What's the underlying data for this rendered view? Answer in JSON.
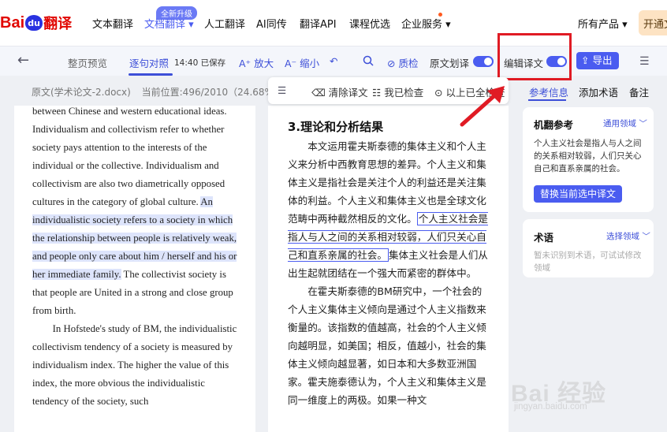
{
  "nav": {
    "logo_text_1": "Bai",
    "logo_paw": "du",
    "logo_text_2": "翻译",
    "items": [
      "文本翻译",
      "文档翻译 ▾",
      "人工翻译",
      "AI同传",
      "翻译API",
      "课程优选",
      "企业服务 ▾"
    ],
    "new_badge": "全新升级",
    "all_products": "所有产品 ▾",
    "trial_label": "开通文"
  },
  "toolbar": {
    "back_icon": "←",
    "preview_tab": "整页预览",
    "compare_tab": "逐句对照",
    "saved_status": "14:40 已保存",
    "zoom_in": "放大",
    "zoom_out": "缩小",
    "quality_check": "质检",
    "source_hint": "原文划译",
    "edit_translation": "编辑译文",
    "export": "导出"
  },
  "doc_info": {
    "filename": "原文(学术论文-2.docx)",
    "position": "当前位置:496/2010（24.68%"
  },
  "float_toolbar": {
    "clear": "清除译文",
    "checked": "我已检查",
    "above_checked": "以上已全检查"
  },
  "source": {
    "paragraphs": [
      [
        {
          "t": "between Chinese and western educational ideas. Individualism and collectivism refer to whether society pays attention to the interests of the individual or the collective. Individualism and collectivism are also two diametrically opposed cultures in the category of global culture. ",
          "hl": false
        },
        {
          "t": "An individualistic society refers to a society in which the relationship between people is relatively weak, and people only care about him / herself and his or her immediate family.",
          "hl": true
        },
        {
          "t": " The collectivist society is that people are United in a strong and close group from birth.",
          "hl": false
        }
      ],
      [
        {
          "t": "In Hofstede's study of BM, the individualistic collectivism tendency of a society is measured by individualism index. The higher the value of this index, the more obvious the individualistic tendency of the society, such",
          "hl": false
        }
      ]
    ]
  },
  "translation": {
    "heading": "3.理论和分析结果",
    "paragraphs": [
      [
        {
          "t": "本文运用霍夫斯泰德的集体主义和个人主义来分析中西教育思想的差异。个人主义和集体主义是指社会是关注个人的利益还是关注集体的利益。个人主义和集体主义也是全球文化范畴中两种截然相反的文化。",
          "box": false
        },
        {
          "t": "个人主义社会是指人与人之间的关系相对较弱，人们只关心自己和直系亲属的社会。",
          "box": true
        },
        {
          "t": "集体主义社会是人们从出生起就团结在一个强大而紧密的群体中。",
          "box": false
        }
      ],
      [
        {
          "t": "在霍夫斯泰德的BM研究中，一个社会的个人主义集体主义倾向是通过个人主义指数来衡量的。该指数的值越高，社会的个人主义倾向越明显，如美国；相反，值越小，社会的集体主义倾向越显著，如日本和大多数亚洲国家。霍夫施泰德认为，个人主义和集体主义是同一维度上的两极。如果一种文",
          "box": false
        }
      ]
    ]
  },
  "right_panel": {
    "tabs": [
      "参考信息",
      "添加术语",
      "备注"
    ],
    "mt_card": {
      "title": "机翻参考",
      "domain": "通用领域 ﹀",
      "text": "个人主义社会是指人与人之间的关系相对较弱，人们只关心自己和直系亲属的社会。",
      "replace_btn": "替换当前选中译文"
    },
    "term_card": {
      "title": "术语",
      "domain": "选择领域 ﹀",
      "empty": "暂未识别到术语，可试试修改领域"
    }
  },
  "watermark": {
    "logo": "Bai 经验",
    "url": "jingyan.baidu.com"
  },
  "colors": {
    "accent": "#4a5cf0",
    "highlight_red": "#e01b24",
    "source_highlight": "#dde4fb"
  }
}
